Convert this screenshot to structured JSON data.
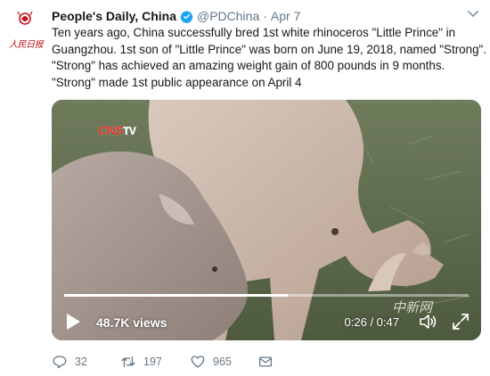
{
  "account": {
    "display_name": "People's Daily, China",
    "handle": "@PDChina",
    "separator": "·",
    "date": "Apr 7",
    "avatar_logo_text": "人民日报"
  },
  "tweet": {
    "lines": [
      "Ten years ago, China successfully bred 1st white rhinoceros \"Little Prince\" in",
      "Guangzhou.  1st son of \"Little Prince\" was born on June 19, 2018, named \"Strong\".",
      "\"Strong\" has achieved an amazing weight gain of 800 pounds in 9 months.",
      "\"Strong\" made 1st public appearance on April 4"
    ]
  },
  "video": {
    "channel_logo": "CNS",
    "channel_logo_suffix": "TV",
    "watermark": "中新网",
    "views": "48.7K views",
    "time": "0:26 / 0:47",
    "progress_fraction": 0.553
  },
  "actions": {
    "reply_count": "32",
    "retweet_count": "197",
    "like_count": "965"
  },
  "icons": {
    "verified": "verified-badge-icon",
    "caret": "chevron-down-icon",
    "play": "play-icon",
    "volume": "volume-icon",
    "fullscreen": "fullscreen-icon",
    "reply": "reply-icon",
    "retweet": "retweet-icon",
    "like": "heart-icon",
    "message": "envelope-icon"
  },
  "colors": {
    "verified_blue": "#1da1f2",
    "text_primary": "#14171a",
    "text_secondary": "#657786",
    "brand_red": "#c4141b"
  }
}
